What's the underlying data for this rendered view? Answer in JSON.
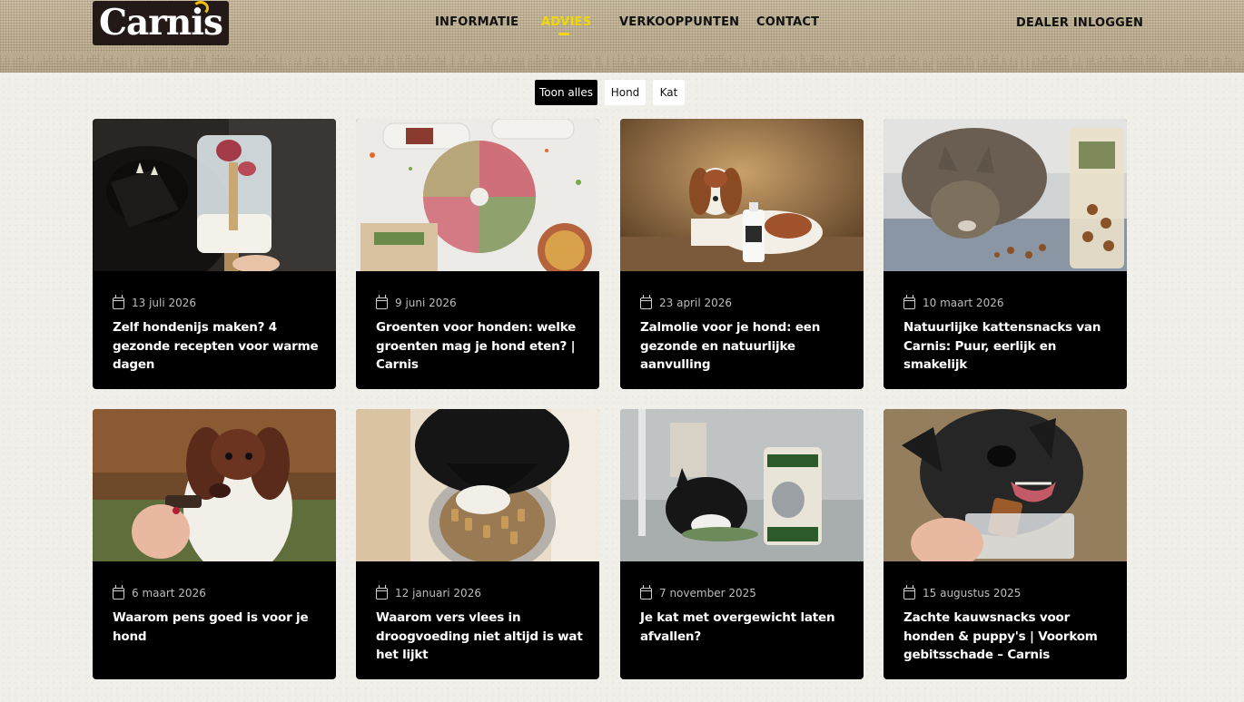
{
  "brand": {
    "logo_text": "Carnis",
    "accent": "#f2d800"
  },
  "nav": {
    "items": [
      {
        "label": "INFORMATIE",
        "active": false
      },
      {
        "label": "ADVIES",
        "active": true
      },
      {
        "label": "VERKOOPPUNTEN",
        "active": false
      },
      {
        "label": "CONTACT",
        "active": false
      }
    ],
    "dealer_login": "DEALER INLOGGEN"
  },
  "filters": [
    {
      "label": "Toon alles",
      "selected": true
    },
    {
      "label": "Hond",
      "selected": false
    },
    {
      "label": "Kat",
      "selected": false
    }
  ],
  "articles": [
    {
      "date": "13 juli 2026",
      "title": "Zelf hondenijs maken? 4 gezonde recepten voor warme dagen",
      "image": "dog-ice-popsicle"
    },
    {
      "date": "9 juni 2026",
      "title": "Groenten voor honden: welke groenten mag je hond eten? | Carnis",
      "image": "vegetables-and-meat"
    },
    {
      "date": "23 april 2026",
      "title": "Zalmolie voor je hond: een gezonde en natuurlijke aanvulling",
      "image": "spaniel-with-salmon-oil"
    },
    {
      "date": "10 maart 2026",
      "title": "Natuurlijke kattensnacks van Carnis: Puur, eerlijk en smakelijk",
      "image": "cat-eating-snacks"
    },
    {
      "date": "6 maart 2026",
      "title": "Waarom pens goed is voor je hond",
      "image": "border-collie-treat"
    },
    {
      "date": "12 januari 2026",
      "title": "Waarom vers vlees in droogvoeding niet altijd is wat het lijkt",
      "image": "dog-eating-from-bowl"
    },
    {
      "date": "7 november 2025",
      "title": "Je kat met overgewicht laten afvallen?",
      "image": "cat-with-food-bag"
    },
    {
      "date": "15 augustus 2025",
      "title": "Zachte kauwsnacks voor honden & puppy's | Voorkom gebitsschade – Carnis",
      "image": "dog-chew-snack"
    }
  ]
}
